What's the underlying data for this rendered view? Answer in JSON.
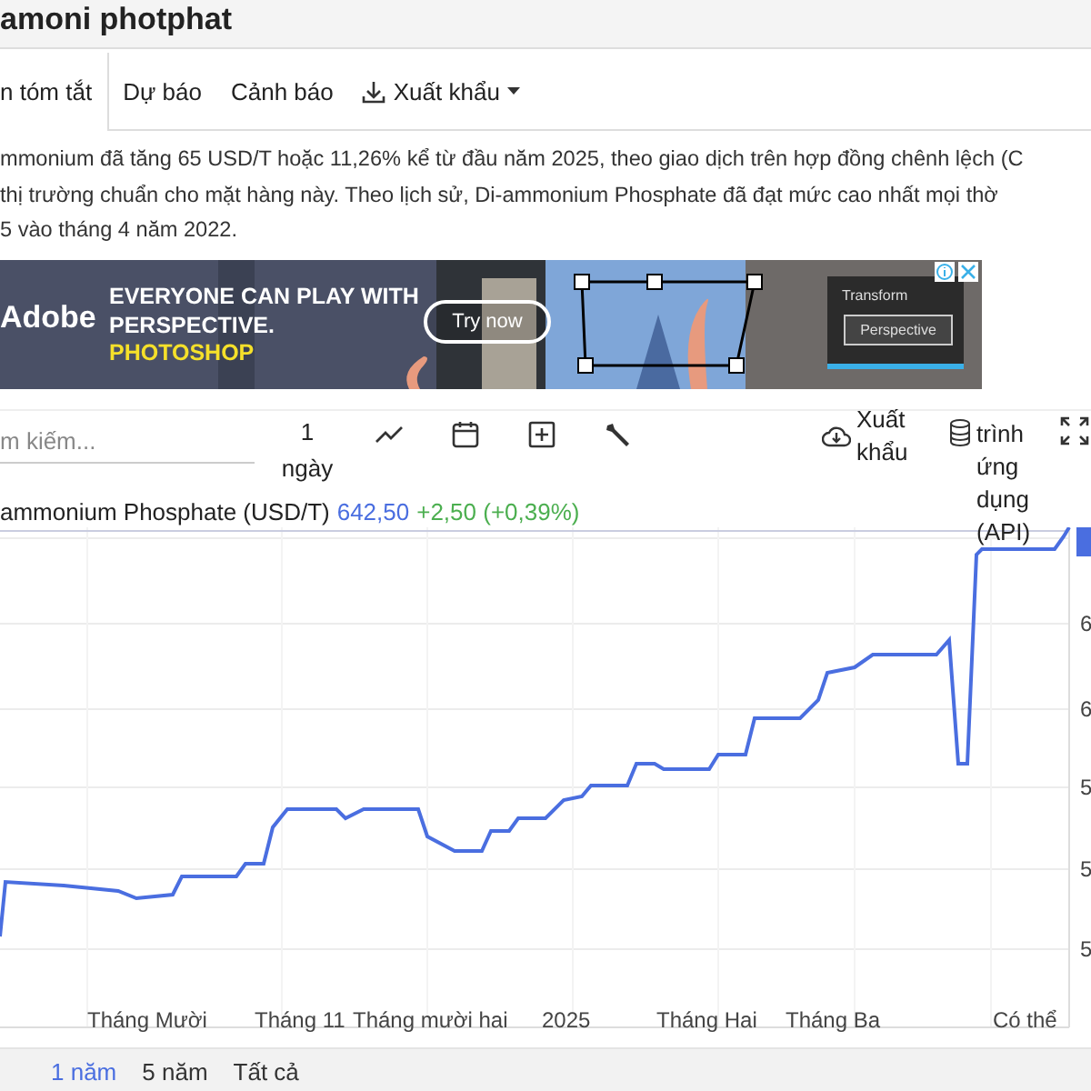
{
  "title": "amoni photphat",
  "tabs": [
    {
      "label": "n tóm tắt",
      "selected": true,
      "kind": "plain"
    },
    {
      "label": "Dự báo",
      "selected": false,
      "kind": "plain"
    },
    {
      "label": "Cảnh báo",
      "selected": false,
      "kind": "plain"
    },
    {
      "label": "Xuất khẩu",
      "selected": false,
      "kind": "export"
    }
  ],
  "summary": [
    "mmonium đã tăng 65 USD/T hoặc 11,26% kể từ đầu năm 2025, theo giao dịch trên hợp đồng chênh lệch (C",
    "thị trường chuẩn cho mặt hàng này. Theo lịch sử, Di-ammonium Phosphate đã đạt mức cao nhất mọi thờ",
    "5 vào tháng 4 năm 2022."
  ],
  "ad": {
    "brand": "Adobe",
    "headline": "EVERYONE CAN PLAY WITH PERSPECTIVE.",
    "product": "PHOTOSHOP",
    "cta": "Try now",
    "panel_title": "Transform",
    "panel_button": "Perspective"
  },
  "toolbar": {
    "search": {
      "placeholder": "m kiếm..."
    },
    "interval": "1 ngày",
    "export": "Xuất khẩu",
    "api": "trình ứng dụng (API)"
  },
  "legend": {
    "name": "ammonium Phosphate (USD/T)",
    "price": "642,50",
    "change": "+2,50 (+0,39%)"
  },
  "chart": {
    "y_labels": [
      "6",
      "6",
      "5",
      "5",
      "5"
    ],
    "x_labels": [
      "Tháng Mười",
      "Tháng 11",
      "Tháng mười hai",
      "2025",
      "Tháng Hai",
      "Tháng Ba",
      "Có thể"
    ]
  },
  "ranges": [
    {
      "label": "1 năm",
      "selected": true
    },
    {
      "label": "5 năm",
      "selected": false
    },
    {
      "label": "Tất cả",
      "selected": false
    }
  ]
}
